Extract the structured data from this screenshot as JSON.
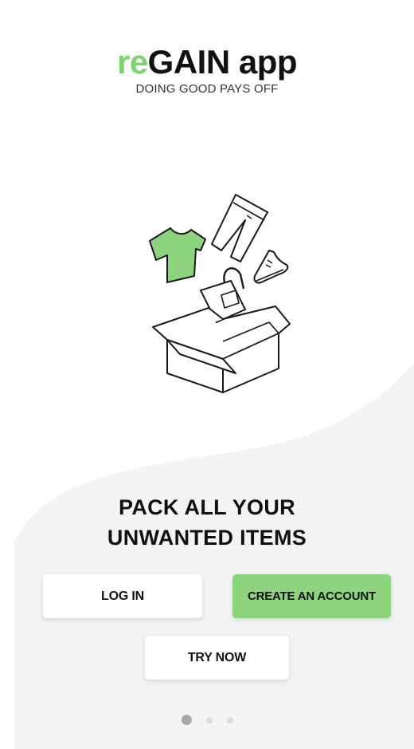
{
  "brand": {
    "logo_prefix": "re",
    "logo_main": "GAIN app",
    "tagline": "DOING GOOD PAYS OFF",
    "accent_color": "#7ed36f",
    "button_accent": "#8ed47e"
  },
  "illustration": {
    "icons": [
      "tshirt-icon",
      "pants-icon",
      "sneaker-icon",
      "handbag-icon",
      "open-box-icon"
    ]
  },
  "onboarding": {
    "headline_line1": "PACK ALL YOUR",
    "headline_line2": "UNWANTED ITEMS",
    "current_page": 1,
    "total_pages": 3
  },
  "actions": {
    "login_label": "LOG IN",
    "create_account_label": "CREATE AN ACCOUNT",
    "try_now_label": "TRY NOW"
  }
}
